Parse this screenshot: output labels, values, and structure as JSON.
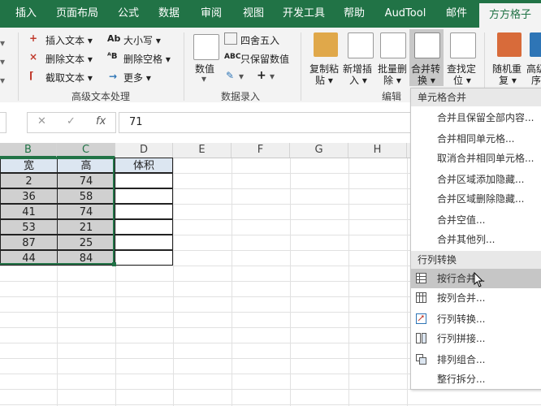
{
  "tabs": [
    "插入",
    "页面布局",
    "公式",
    "数据",
    "审阅",
    "视图",
    "开发工具",
    "帮助",
    "AudTool",
    "邮件",
    "方方格子"
  ],
  "ribbon": {
    "text_group": {
      "insert_text": "插入文本",
      "delete_text": "删除文本",
      "cut_text": "截取文本",
      "case": "大小写",
      "delete_space": "删除空格",
      "more": "更多",
      "label": "高级文本处理"
    },
    "number_group": {
      "value_btn": "数值",
      "round": "四舍五入",
      "keep_value": "只保留数值",
      "label": "数据录入"
    },
    "edit_group": {
      "copy_paste": "复制粘",
      "copy_paste2": "贴",
      "add_insert": "新增插",
      "add_insert2": "入",
      "batch_delete": "批量删",
      "batch_delete2": "除",
      "merge_convert": "合并转",
      "merge_convert2": "换",
      "find_locate": "查找定",
      "find_locate2": "位",
      "label": "编辑"
    },
    "random_group": {
      "random": "随机重",
      "random2": "复",
      "advanced": "高级",
      "advanced2": "序"
    }
  },
  "formula_bar": {
    "cancel": "✕",
    "confirm": "✓",
    "fx": "fx",
    "value": "71"
  },
  "columns": [
    "B",
    "C",
    "D",
    "E",
    "F",
    "G",
    "H"
  ],
  "sheet": {
    "headers": [
      "宽",
      "高",
      "体积"
    ],
    "rows": [
      [
        "2",
        "74",
        ""
      ],
      [
        "36",
        "58",
        ""
      ],
      [
        "41",
        "74",
        ""
      ],
      [
        "53",
        "21",
        ""
      ],
      [
        "87",
        "25",
        ""
      ],
      [
        "44",
        "84",
        ""
      ]
    ]
  },
  "menu": {
    "section1": "单元格合并",
    "section1_items": [
      "合并且保留全部内容...",
      "合并相同单元格...",
      "取消合并相同单元格...",
      "合并区域添加隐藏...",
      "合并区域删除隐藏...",
      "合并空值...",
      "合并其他列..."
    ],
    "section2": "行列转换",
    "section2_items": [
      "按行合并...",
      "按列合并...",
      "行列转换...",
      "行列拼接...",
      "排列组合...",
      "整行拆分..."
    ]
  },
  "colors": {
    "brand": "#217346",
    "selection": "#d0d0d0",
    "menu_highlight": "#c6c6c6"
  }
}
